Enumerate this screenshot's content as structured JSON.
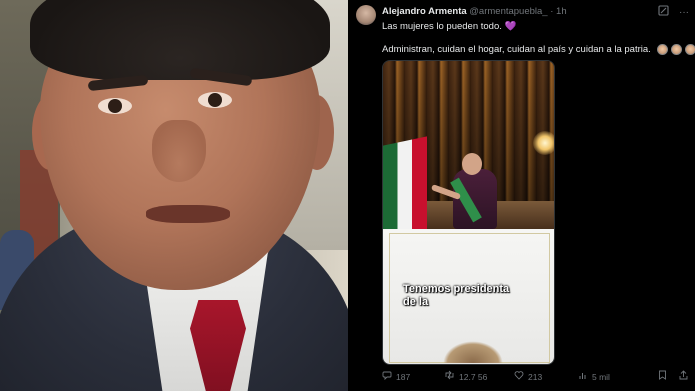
{
  "tweet": {
    "author": "Alejandro Armenta",
    "handle": "@armentapuebla_",
    "separator": "·",
    "time": "1h",
    "line1": "Las mujeres lo pueden todo.",
    "line1_emoji": "💜",
    "line2": "Administran, cuidan el hogar, cuidan al país y cuidan a la patria.",
    "video_caption_line1": "Tenemos presidenta",
    "video_caption_line2": "de la",
    "replies": "187",
    "reposts": "12.7 56",
    "likes": "213",
    "views": "5 mil"
  },
  "icons": {
    "header": [
      "grok-icon",
      "more-icon"
    ],
    "actions": [
      "reply-icon",
      "repost-icon",
      "like-icon",
      "views-icon",
      "bookmark-icon",
      "share-icon"
    ]
  },
  "colors": {
    "background": "#000000",
    "text": "#e7e9ea",
    "muted": "#71767b",
    "heart": "#a56ad6"
  }
}
